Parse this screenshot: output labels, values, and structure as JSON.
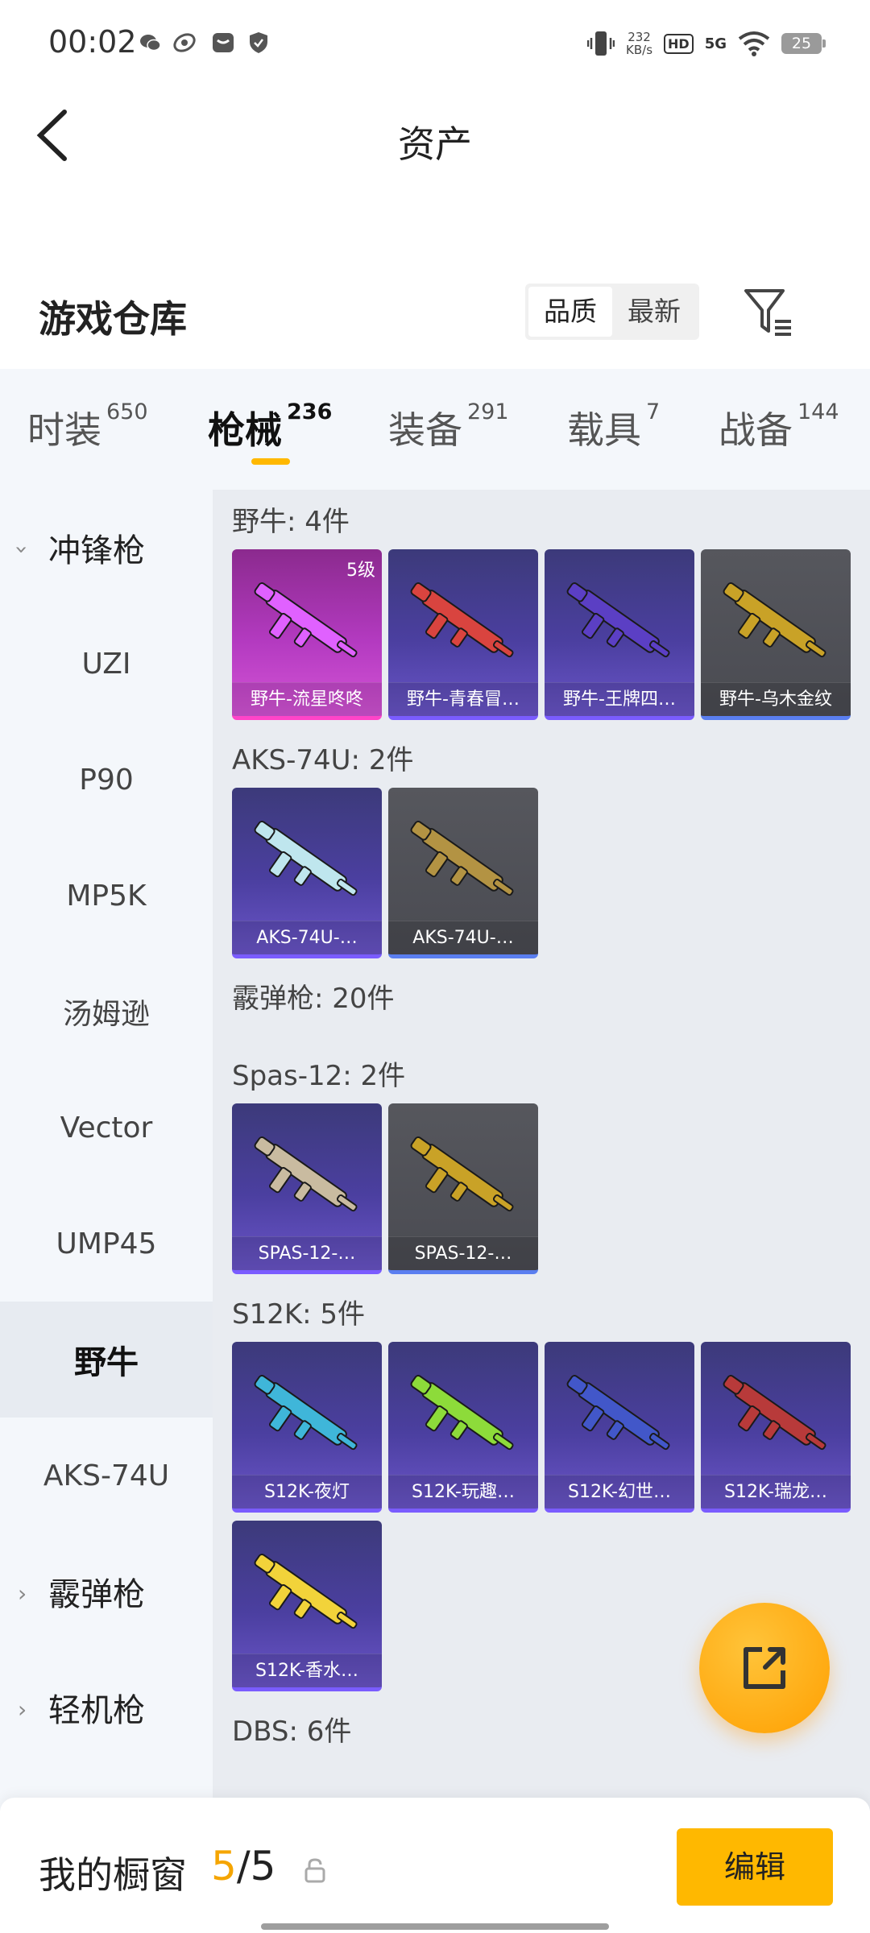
{
  "status_bar": {
    "time": "00:02",
    "speed_value": "232",
    "speed_unit": "KB/s",
    "hd": "HD",
    "network": "5G",
    "battery": "25"
  },
  "header": {
    "title": "资产"
  },
  "warehouse": {
    "title": "游戏仓库",
    "sort_options": [
      "品质",
      "最新"
    ],
    "sort_active": "品质"
  },
  "tabs": [
    {
      "label": "时装",
      "count": "650"
    },
    {
      "label": "枪械",
      "count": "236"
    },
    {
      "label": "装备",
      "count": "291"
    },
    {
      "label": "载具",
      "count": "7"
    },
    {
      "label": "战备",
      "count": "144"
    }
  ],
  "active_tab": "枪械",
  "sidebar": [
    {
      "label": "冲锋枪",
      "type": "group",
      "expanded": true
    },
    {
      "label": "UZI"
    },
    {
      "label": "P90"
    },
    {
      "label": "MP5K"
    },
    {
      "label": "汤姆逊"
    },
    {
      "label": "Vector"
    },
    {
      "label": "UMP45"
    },
    {
      "label": "野牛",
      "active": true
    },
    {
      "label": "AKS-74U"
    },
    {
      "label": "霰弹枪",
      "type": "group",
      "expanded": false
    },
    {
      "label": "轻机枪",
      "type": "group",
      "expanded": false
    }
  ],
  "groups": [
    {
      "label": "野牛: 4件",
      "items": [
        {
          "name": "野牛-流星咚咚",
          "quality": "pink",
          "badge": "5级",
          "color": "#e061ff"
        },
        {
          "name": "野牛-青春冒…",
          "quality": "purple",
          "color": "#d9443f"
        },
        {
          "name": "野牛-王牌四…",
          "quality": "purple",
          "color": "#5b3fc4"
        },
        {
          "name": "野牛-乌木金纹",
          "quality": "gray",
          "color": "#c9a227"
        }
      ]
    },
    {
      "label": "AKS-74U: 2件",
      "items": [
        {
          "name": "AKS-74U-…",
          "quality": "purple",
          "color": "#bfe6ee"
        },
        {
          "name": "AKS-74U-…",
          "quality": "gray",
          "color": "#b39343"
        }
      ]
    },
    {
      "label": "霰弹枪: 20件",
      "items": []
    },
    {
      "label": "Spas-12: 2件",
      "items": [
        {
          "name": "SPAS-12-…",
          "quality": "purple",
          "color": "#c9bba0"
        },
        {
          "name": "SPAS-12-…",
          "quality": "gray",
          "color": "#c9a227"
        }
      ]
    },
    {
      "label": "S12K: 5件",
      "items": [
        {
          "name": "S12K-夜灯",
          "quality": "purple",
          "color": "#3fb6d9"
        },
        {
          "name": "S12K-玩趣…",
          "quality": "purple",
          "color": "#8ddb3a"
        },
        {
          "name": "S12K-幻世…",
          "quality": "purple",
          "color": "#4257c9"
        },
        {
          "name": "S12K-瑞龙…",
          "quality": "purple",
          "color": "#b83a3a"
        },
        {
          "name": "S12K-香水…",
          "quality": "purple",
          "color": "#f2d33a"
        }
      ]
    },
    {
      "label": "DBS: 6件",
      "items": []
    }
  ],
  "bottom_bar": {
    "label": "我的橱窗",
    "current": "5",
    "total": "5",
    "edit_label": "编辑"
  }
}
